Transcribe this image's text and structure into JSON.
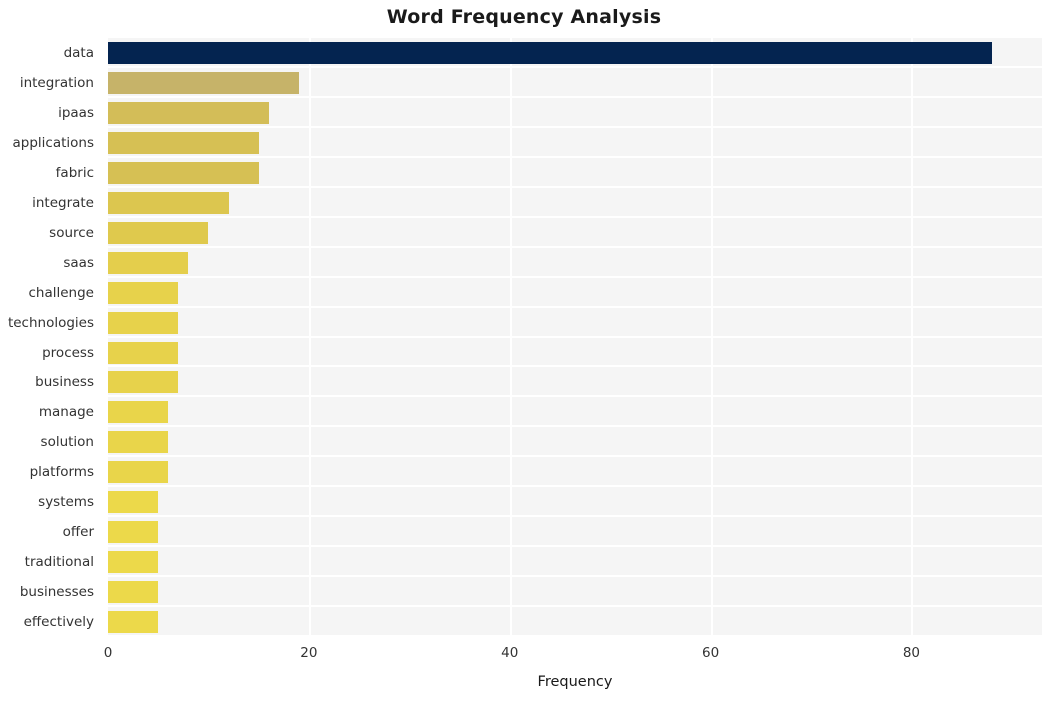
{
  "chart_data": {
    "type": "bar",
    "orientation": "horizontal",
    "title": "Word Frequency Analysis",
    "xlabel": "Frequency",
    "ylabel": "",
    "categories": [
      "data",
      "integration",
      "ipaas",
      "applications",
      "fabric",
      "integrate",
      "source",
      "saas",
      "challenge",
      "technologies",
      "process",
      "business",
      "manage",
      "solution",
      "platforms",
      "systems",
      "offer",
      "traditional",
      "businesses",
      "effectively"
    ],
    "values": [
      88,
      19,
      16,
      15,
      15,
      12,
      10,
      8,
      7,
      7,
      7,
      7,
      6,
      6,
      6,
      5,
      5,
      5,
      5,
      5
    ],
    "xlim": [
      0,
      93
    ],
    "xticks": [
      0,
      20,
      40,
      60,
      80
    ],
    "xtick_labels": [
      "0",
      "20",
      "40",
      "60",
      "80"
    ],
    "grid": true,
    "legend": "none",
    "bar_colors": [
      "#042450",
      "#c6b369",
      "#d3bd58",
      "#d6c054",
      "#d6c054",
      "#dcc64f",
      "#dfc94d",
      "#e4ce4c",
      "#e7d24b",
      "#e7d24b",
      "#e7d24b",
      "#e7d24b",
      "#e9d54a",
      "#e9d54a",
      "#e9d54a",
      "#ecd94a",
      "#ecd94a",
      "#ecd94a",
      "#ecd94a",
      "#ecd94a"
    ],
    "plot_background": "#f5f5f5",
    "gridline_color": "#ffffff",
    "figure_background": "#ffffff"
  }
}
